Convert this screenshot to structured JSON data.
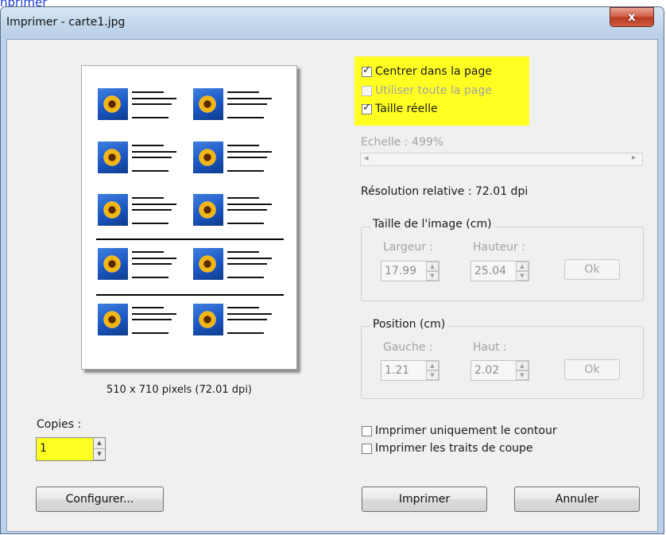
{
  "top_link": "nprimer",
  "window": {
    "title": "Imprimer - carte1.jpg",
    "close_label": "x"
  },
  "preview": {
    "caption": "510 x 710 pixels (72.01 dpi)"
  },
  "options": {
    "center_in_page": {
      "label": "Centrer dans la page",
      "checked": true
    },
    "use_full_page": {
      "label": "Utiliser toute la page",
      "checked": false,
      "disabled": true
    },
    "actual_size": {
      "label": "Taille réelle",
      "checked": true
    }
  },
  "scale": {
    "label": "Echelle : 499%"
  },
  "resolution": "Résolution relative : 72.01 dpi",
  "image_size": {
    "title": "Taille de l'image (cm)",
    "width_label": "Largeur :",
    "width_value": "17.99",
    "height_label": "Hauteur :",
    "height_value": "25.04",
    "ok_label": "Ok"
  },
  "position": {
    "title": "Position (cm)",
    "left_label": "Gauche :",
    "left_value": "1.21",
    "top_label": "Haut :",
    "top_value": "2.02",
    "ok_label": "Ok"
  },
  "copies": {
    "label": "Copies :",
    "value": "1"
  },
  "print_options": {
    "outline_only": {
      "label": "Imprimer uniquement le contour",
      "checked": false
    },
    "cut_lines": {
      "label": "Imprimer les traits de coupe",
      "checked": false
    }
  },
  "buttons": {
    "configure": "Configurer...",
    "print": "Imprimer",
    "cancel": "Annuler"
  },
  "colors": {
    "highlight": "#ffff22",
    "title_bar": "#c3d7ec",
    "close_button": "#cf5a40",
    "link": "#1f3fd6"
  }
}
